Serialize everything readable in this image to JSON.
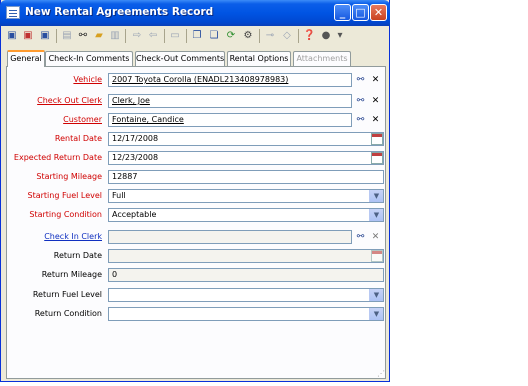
{
  "window": {
    "title": "New Rental Agreements Record"
  },
  "toolbar_icons": [
    "save-icon",
    "save-close-icon",
    "save-new-icon",
    "print-icon",
    "find-icon",
    "open-folder-icon",
    "notes-icon",
    "forward-icon",
    "backward-icon",
    "field-icon",
    "copy-icon",
    "paste-icon",
    "refresh-icon",
    "settings-icon",
    "link-icon",
    "tag-icon",
    "help-icon",
    "info-icon",
    "overflow-icon"
  ],
  "tabs": [
    {
      "label": "General"
    },
    {
      "label": "Check-In Comments"
    },
    {
      "label": "Check-Out Comments"
    },
    {
      "label": "Rental Options"
    },
    {
      "label": "Attachments"
    }
  ],
  "form": {
    "vehicle": {
      "label": "Vehicle",
      "value": "2007 Toyota Corolla (ENADL213408978983)"
    },
    "check_out_clerk": {
      "label": "Check Out Clerk",
      "value": "Clerk, Joe"
    },
    "customer": {
      "label": "Customer",
      "value": "Fontaine, Candice"
    },
    "rental_date": {
      "label": "Rental Date",
      "value": "12/17/2008"
    },
    "expected_return_date": {
      "label": "Expected Return Date",
      "value": "12/23/2008"
    },
    "starting_mileage": {
      "label": "Starting Mileage",
      "value": "12887"
    },
    "starting_fuel_level": {
      "label": "Starting Fuel Level",
      "value": "Full"
    },
    "starting_condition": {
      "label": "Starting Condition",
      "value": "Acceptable"
    },
    "check_in_clerk": {
      "label": "Check In Clerk",
      "value": ""
    },
    "return_date": {
      "label": "Return Date",
      "value": ""
    },
    "return_mileage": {
      "label": "Return Mileage",
      "value": "0"
    },
    "return_fuel_level": {
      "label": "Return Fuel Level",
      "value": ""
    },
    "return_condition": {
      "label": "Return Condition",
      "value": ""
    }
  },
  "colors": {
    "required_label": "#d00000",
    "link_label": "#1030c0",
    "title_bar": "#0054e3",
    "window_bg": "#ece9d8"
  }
}
